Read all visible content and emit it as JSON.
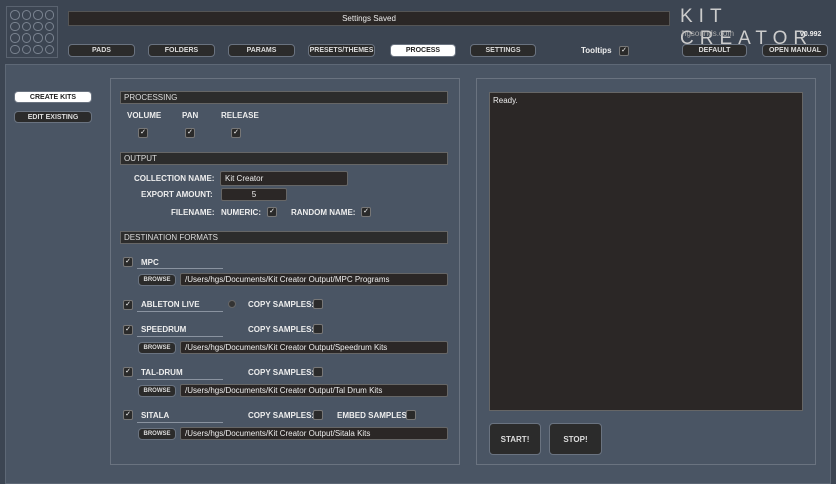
{
  "header": {
    "status": "Settings Saved",
    "tabs": [
      "PADS",
      "FOLDERS",
      "PARAMS",
      "PRESETS/THEMES",
      "PROCESS",
      "SETTINGS"
    ],
    "active_tab": "PROCESS",
    "tooltips_label": "Tooltips",
    "tooltips_checked": true,
    "default_label": "DEFAULT",
    "manual_label": "OPEN MANUAL",
    "brand": "KIT CREATOR",
    "site": "hgsounds.com",
    "version": "v0.992"
  },
  "side": {
    "create": "CREATE KITS",
    "edit": "EDIT EXISTING"
  },
  "processing": {
    "title": "PROCESSING",
    "volume": "VOLUME",
    "pan": "PAN",
    "release": "RELEASE"
  },
  "output": {
    "title": "OUTPUT",
    "collection_label": "COLLECTION NAME:",
    "collection_value": "Kit Creator",
    "export_label": "EXPORT AMOUNT:",
    "export_value": "5",
    "filename_label": "FILENAME:",
    "numeric_label": "NUMERIC:",
    "random_label": "RANDOM NAME:"
  },
  "dest": {
    "title": "DESTINATION FORMATS",
    "browse": "BROWSE",
    "copy": "COPY SAMPLES:",
    "embed": "EMBED SAMPLES:",
    "formats": [
      {
        "name": "MPC",
        "path": "/Users/hgs/Documents/Kit Creator Output/MPC Programs"
      },
      {
        "name": "ABLETON LIVE"
      },
      {
        "name": "SPEEDRUM",
        "path": "/Users/hgs/Documents/Kit Creator Output/Speedrum Kits"
      },
      {
        "name": "TAL-DRUM",
        "path": "/Users/hgs/Documents/Kit Creator Output/Tal Drum Kits"
      },
      {
        "name": "SITALA",
        "path": "/Users/hgs/Documents/Kit Creator Output/Sitala Kits"
      }
    ]
  },
  "log": {
    "text": "Ready.",
    "start": "START!",
    "stop": "STOP!"
  },
  "check": "✓"
}
